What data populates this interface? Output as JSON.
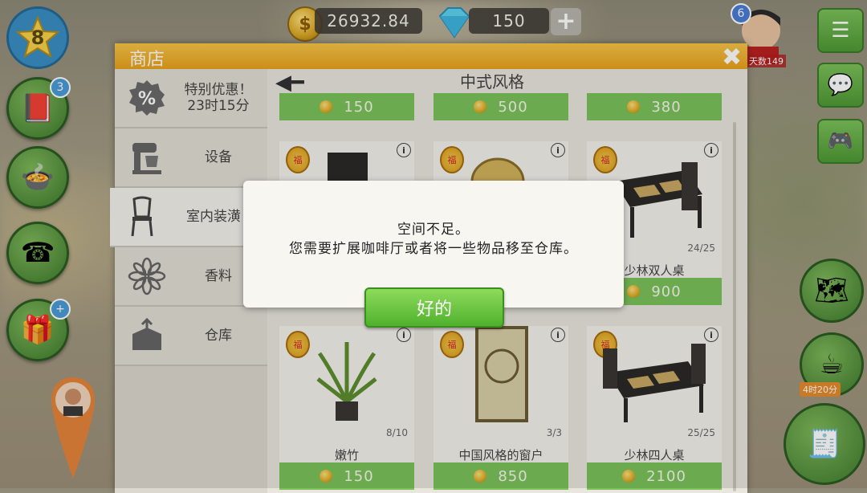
{
  "hud": {
    "level": "8",
    "coins": "26932.84",
    "gems": "150",
    "plus": "+",
    "avatar_badge": "6",
    "days": "天数149",
    "timer": "4时20分",
    "left_badges": [
      "3",
      "+"
    ]
  },
  "shop": {
    "title": "商店",
    "close": "✖",
    "category_title": "中式风格",
    "tabs": [
      {
        "label": "特别优惠！\n23时15分",
        "icon": "percent-icon"
      },
      {
        "label": "设备",
        "icon": "mixer-icon"
      },
      {
        "label": "室内装潢",
        "icon": "chair-icon"
      },
      {
        "label": "香料",
        "icon": "spice-icon"
      },
      {
        "label": "仓库",
        "icon": "storage-box-icon"
      }
    ],
    "top_prices": [
      "150",
      "500",
      "380"
    ],
    "row1": [
      {
        "name": "",
        "count": "",
        "price": ""
      },
      {
        "name": "",
        "count": "",
        "price": ""
      },
      {
        "name": "少林双人桌",
        "count": "24/25",
        "price": "900"
      }
    ],
    "row2": [
      {
        "name": "嫩竹",
        "count": "8/10",
        "price": "150"
      },
      {
        "name": "中国风格的窗户",
        "count": "3/3",
        "price": "850"
      },
      {
        "name": "少林四人桌",
        "count": "25/25",
        "price": "2100"
      }
    ]
  },
  "dialog": {
    "line1": "空间不足。",
    "line2": "您需要扩展咖啡厅或者将一些物品移至仓库。",
    "ok": "好的"
  },
  "colors": {
    "accent": "#7cc25a",
    "header": "#f0b030"
  }
}
